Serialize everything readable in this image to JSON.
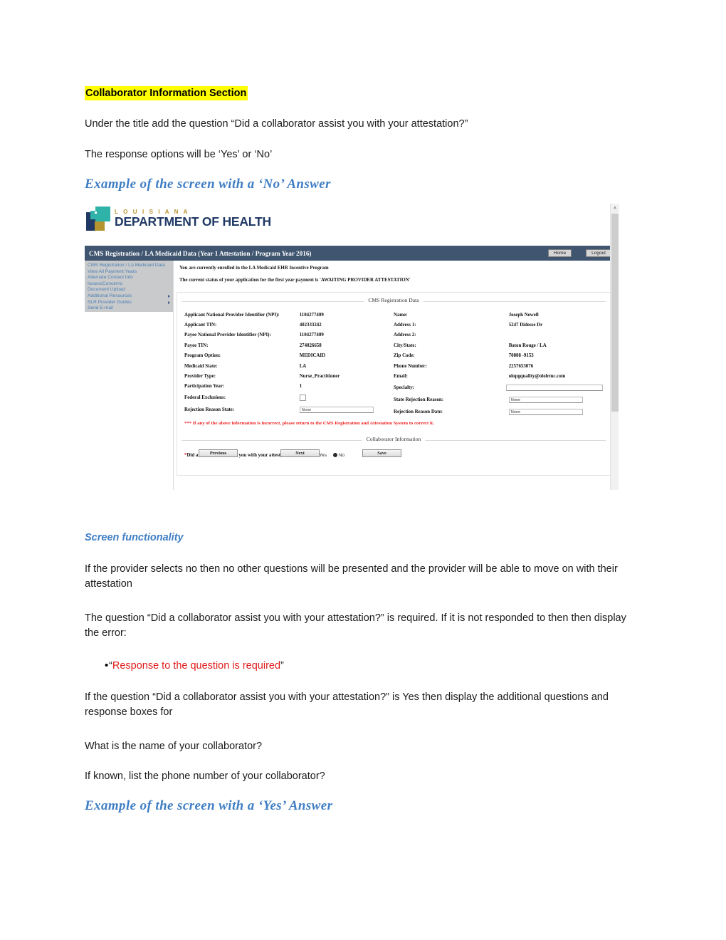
{
  "document": {
    "section_heading": "Collaborator Information Section",
    "paragraph_1": "Under the title add the question “Did a collaborator assist you with your attestation?”",
    "paragraph_2": "The response options will be ‘Yes’ or ‘No’",
    "example_no_heading": "Example of the screen with a ‘No’ Answer",
    "screen_functionality_heading": "Screen functionality",
    "paragraph_3": "If the provider selects no then no other questions will be presented and the provider will be able to move on with their attestation",
    "paragraph_4": "The question “Did a collaborator assist you with your attestation?” is required. If it is not responded to then then display the error:",
    "bullet_error_open": "“",
    "bullet_error_text": "Response to the question is required",
    "bullet_error_close": "”",
    "paragraph_5": "If the question “Did a collaborator assist you with your attestation?” is Yes then display the additional questions and response boxes for",
    "paragraph_6": "What is the name of your collaborator?",
    "paragraph_7": "If known, list the phone number of your collaborator?",
    "example_yes_heading": "Example of the screen with a ‘Yes’ Answer",
    "highlight_color": "#ffff00",
    "heading_color": "#3f7ec4",
    "error_color": "#e01b1b"
  },
  "screenshot": {
    "logo": {
      "line1": "L O U I S I A N A",
      "line2": "DEPARTMENT OF HEALTH",
      "navy": "#1f3864",
      "teal": "#2fb3a8",
      "gold": "#b5932f"
    },
    "appbar": {
      "title": "CMS Registration / LA Medicaid Data   (Year 1 Attestation / Program Year 2016)",
      "background": "#3f5570",
      "home_label": "Home",
      "logout_label": "Logout"
    },
    "sidebar": {
      "background": "#c9cacb",
      "link_color": "#4a7fb5",
      "items": [
        {
          "label": "CMS Registration / LA Medicaid Data",
          "has_arrow": false
        },
        {
          "label": "View All Payment Years",
          "has_arrow": false
        },
        {
          "label": "Alternate Contact Info",
          "has_arrow": false
        },
        {
          "label": "Issues/Concerns",
          "has_arrow": false
        },
        {
          "label": "Document Upload",
          "has_arrow": false
        },
        {
          "label": "Additional Resources",
          "has_arrow": true
        },
        {
          "label": "SLR Provider Guides",
          "has_arrow": true
        },
        {
          "label": "Send E-mail",
          "has_arrow": false
        }
      ]
    },
    "status": {
      "line1": "You are currently enrolled in the LA Medicaid EHR Incentive Program",
      "line2": "The current status of your application for the first year payment is 'AWAITING PROVIDER ATTESTATION'"
    },
    "registration_legend": "CMS Registration Data",
    "fields_left": [
      {
        "label": "Applicant National Provider Identifier (NPI):",
        "value": "1104277409",
        "type": "text"
      },
      {
        "label": "Applicant TIN:",
        "value": "402333242",
        "type": "text"
      },
      {
        "label": "Payee National Provider Identifier (NPI):",
        "value": "1104277409",
        "type": "text"
      },
      {
        "label": "Payee TIN:",
        "value": "274026658",
        "type": "text"
      },
      {
        "label": "Program Option:",
        "value": "MEDICAID",
        "type": "text"
      },
      {
        "label": "Medicaid State:",
        "value": "LA",
        "type": "text"
      },
      {
        "label": "Provider Type:",
        "value": "Nurse_Practitioner",
        "type": "text"
      },
      {
        "label": "Participation Year:",
        "value": "1",
        "type": "text"
      },
      {
        "label": "Federal Exclusions:",
        "value": "",
        "type": "checkbox"
      },
      {
        "label": "Rejection Reason State:",
        "value": "None",
        "type": "input"
      }
    ],
    "fields_right": [
      {
        "label": "Name:",
        "value": "Joseph  Newell",
        "type": "text"
      },
      {
        "label": "Address 1:",
        "value": "5247 Didesse Dr",
        "type": "text"
      },
      {
        "label": "Address 2:",
        "value": "",
        "type": "text"
      },
      {
        "label": "City/State:",
        "value": "Baton Rouge  / LA",
        "type": "text"
      },
      {
        "label": "Zip Code:",
        "value": "70808 -9153",
        "type": "text"
      },
      {
        "label": "Phone Number:",
        "value": "2257653076",
        "type": "text"
      },
      {
        "label": "Email:",
        "value": "olopgquality@ololrmc.com",
        "type": "text"
      },
      {
        "label": "Specialty:",
        "value": "",
        "type": "input_wide"
      },
      {
        "label": "State Rejection Reason:",
        "value": "None",
        "type": "input"
      },
      {
        "label": "Rejection Reason Date:",
        "value": "None",
        "type": "input"
      }
    ],
    "warning": "*** If any of the above information is incorrect, please return to the CMS Registration and Attestation System to correct it.",
    "collaborator_legend": "Collaborator Information",
    "collaborator_question": "Did a collaborator assist you with your attestation?",
    "collaborator_required_marker": "*",
    "collaborator_options": [
      {
        "label": "Yes",
        "selected": false
      },
      {
        "label": "No",
        "selected": true
      }
    ],
    "buttons": [
      {
        "label": "Previous"
      },
      {
        "label": "Next"
      },
      {
        "label": "Save"
      }
    ],
    "scrollbar_arrow": "∧"
  }
}
